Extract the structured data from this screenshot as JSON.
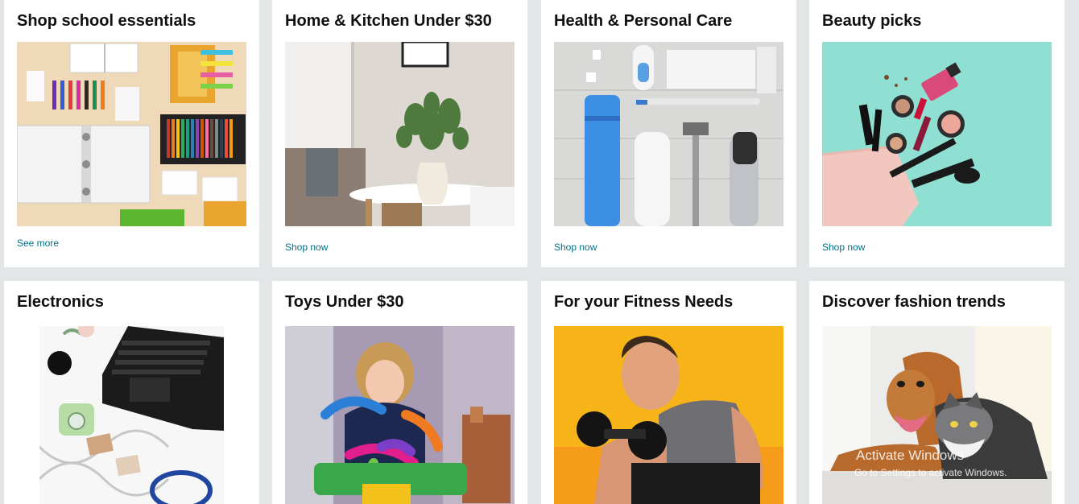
{
  "cards": [
    {
      "title": "Shop school essentials",
      "link": "See more"
    },
    {
      "title": "Home & Kitchen Under $30",
      "link": "Shop now"
    },
    {
      "title": "Health & Personal Care",
      "link": "Shop now"
    },
    {
      "title": "Beauty picks",
      "link": "Shop now"
    },
    {
      "title": "Electronics"
    },
    {
      "title": "Toys Under $30"
    },
    {
      "title": "For your Fitness Needs"
    },
    {
      "title": "Discover fashion trends"
    }
  ],
  "watermark": {
    "line1": "Activate Windows",
    "line2": "Go to Settings to activate Windows."
  },
  "colors": {
    "background": "#e3e6e6",
    "card": "#ffffff",
    "link": "#007185",
    "title": "#0f1111"
  }
}
